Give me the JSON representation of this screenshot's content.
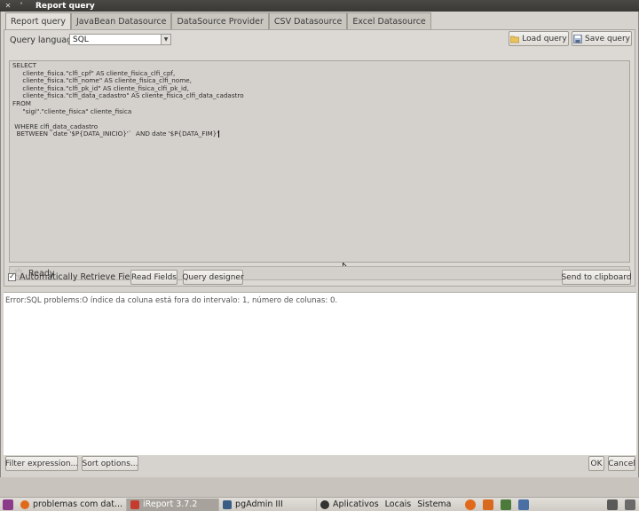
{
  "window": {
    "title": "Report query"
  },
  "tabs": [
    {
      "label": "Report query",
      "active": true
    },
    {
      "label": "JavaBean Datasource",
      "active": false
    },
    {
      "label": "DataSource Provider",
      "active": false
    },
    {
      "label": "CSV Datasource",
      "active": false
    },
    {
      "label": "Excel Datasource",
      "active": false
    }
  ],
  "query": {
    "language_label": "Query language",
    "language_value": "SQL",
    "load_label": "Load query",
    "save_label": "Save query",
    "sql_lines": [
      "SELECT",
      "     cliente_fisica.\"clfi_cpf\" AS cliente_fisica_clfi_cpf,",
      "     cliente_fisica.\"clfi_nome\" AS cliente_fisica_clfi_nome,",
      "     cliente_fisica.\"clfi_pk_id\" AS cliente_fisica_clfi_pk_id,",
      "     cliente_fisica.\"clfi_data_cadastro\" AS cliente_fisica_clfi_data_cadastro",
      "FROM",
      "     \"sigi\".\"cliente_fisica\" cliente_fisica",
      "",
      " WHERE clfi_data_cadastro",
      "  BETWEEN `date '$P{DATA_INICIO}'`  AND date '$P{DATA_FIM}'"
    ]
  },
  "status": {
    "text": "Ready"
  },
  "options": {
    "auto_retrieve_label": "Automatically Retrieve Fields",
    "auto_retrieve_checked": true,
    "read_fields_label": "Read Fields",
    "query_designer_label": "Query designer",
    "send_clipboard_label": "Send to clipboard"
  },
  "results": {
    "error": "Error:SQL problems:O índice da coluna está fora do intervalo: 1, número de colunas: 0."
  },
  "footer": {
    "filter_label": "Filter expression...",
    "sort_label": "Sort options...",
    "ok_label": "OK",
    "cancel_label": "Cancel"
  },
  "taskbar": {
    "tasks": [
      {
        "label": "problemas com dat...",
        "active": false
      },
      {
        "label": "iReport 3.7.2",
        "active": true
      },
      {
        "label": "pgAdmin III",
        "active": false
      }
    ],
    "menus": [
      "Aplicativos",
      "Locais",
      "Sistema"
    ]
  }
}
